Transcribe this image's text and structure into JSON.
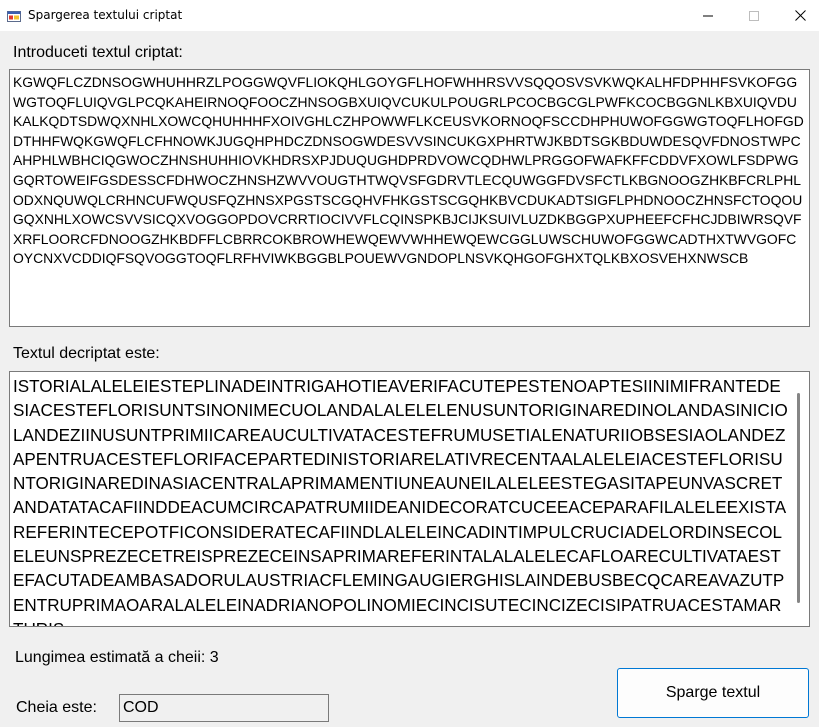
{
  "window": {
    "title": "Spargerea textului criptat",
    "controls": [
      "minimize",
      "maximize",
      "close"
    ]
  },
  "cipher_section": {
    "label": "Introduceti textul criptat:",
    "value": "KGWQFLCZDNSOGWHUHHRZLPOGGWQVFLIOKQHLGOYGFLHOFWHHRSVVSQQOSVSVKWQKALHFDPHHFSVKOFGGWGTOQFLUIQVGLPCQKAHEIRNOQFOOCZHNSOGBXUIQVCUKULPOUGRLPCOCBGCGLPWFKCOCBGGNLKBXUIQVDUKALKQDTSDWQXNHLXOWCQHUHHHFXOIVGHLCZHPOWWFLKCEUSVKORNOQFSCCDHPHUWOFGGWGTOQFLHOFGDDTHHFWQKGWQFLCFHNOWKJUGQHPHDCZDNSOGWDESVVSINCUKGXPHRTWJKBDTSGKBDUWDESQVFDNOSTWPCAHPHLWBHCIQGWOCZHNSHUHHIOVKHDRSXPJDUQUGHDPRDVOWCQDHWLPRGGOFWAFKFFCDDVFXOWLFSDPWGGQRTOWEIFGSDESSCFDHWOCZHNSHZWVVOUGTHTWQVSFGDRVTLECQUWGGFDVSFCTLKBGNOOGZHKBFCRLPHLODXNQUWQLCRHNCUFWQUSFQZHNSXPGSTSCGQHVFHKGSTSCGQHKBVCDUKADTSIGFLPHDNOOCZHNSFCTOQOUGQXNHLXOWCSVVSICQXVOGGOPDOVCRRTIOCIVVFLCQINSPKBJCIJKSUIVLUZDKBGGPXUPHEEFCFHCJDBIWRSQVFXRFLOORCFDNOOGZHKBDFFLCBRRCOKBROWHEWQEWVWHHEWQEWCGGLUWSCHUWOFGGWCADTHXTWVGOFCOYCNXVCDDIQFSQVOGGTOQFLRFHVIWKBGGBLPOUEWVGNDOPLNSVKQHGOFGHXTQLKBXOSVEHXNWSCB"
  },
  "plain_section": {
    "label": "Textul decriptat este:",
    "value": "ISTORIALALELEIESTEPLINADEINTRIGAHOTIEAVERIFACUTEPESTENOAPTESIINIMIFRANTEDESIACESTEFLORISUNTSINONIMECUOLANDALALELELENUSUNTORIGINAREDINOLANDASINICIOLANDEZIINUSUNTPRIMIICAREAUCULTIVATACESTEFRUMUSETIALENATURIIOBSESIAOLANDEZAPENTRUACESTEFLORIFACEPARTEDINISTORIARELATIVRECENTAALALELEIACESTEFLORISUNTORIGINAREDINASIACENTRALAPRIMAMENTIUNEAUNEILALELEESTEGASITAPEUNVASCRETANDATATACAFIINDDEACUMCIRCAPATRUMIIDEANIDECORATCUCEEACEPARAFILALELEEXISTAREFERINTECEPOTFICONSIDERATECAFIINDLALELEINCADINTIMPULCRUCIADELORDINSECOLELEUNSPREZECETREISPREZECEINSAPRIMAREFERINTALALALELECAFLOARECULTIVATAESTEFACUTADEAMBASADORULAUSTRIACFLEMINGAUGIERGHISLAINDEBUSBECQCAREAVAZUTPENTRUPRIMAOARALALELEINADRIANOPOLINOMIECINCISUTECINCIZECISIPATRUACESTAMARTURIS"
  },
  "estimated_length": {
    "label": "Lungimea estimată a cheii:",
    "value": "3"
  },
  "key": {
    "label": "Cheia este:",
    "value": "COD"
  },
  "actions": {
    "crack_label": "Sparge textul"
  }
}
